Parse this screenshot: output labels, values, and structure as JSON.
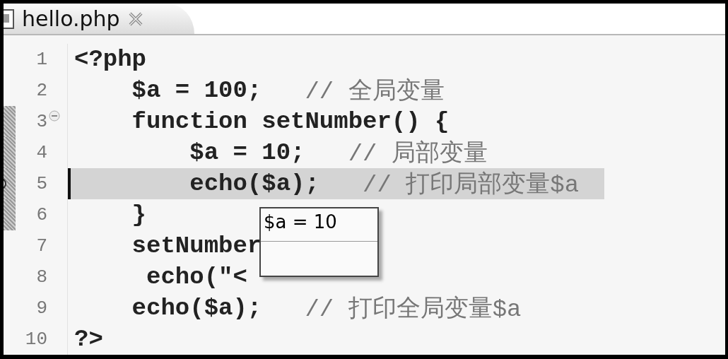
{
  "tab": {
    "title": "hello.php",
    "selected": true
  },
  "lines": [
    {
      "number": "1",
      "code": "<?php",
      "current": false,
      "foldable": false,
      "scope": false
    },
    {
      "number": "2",
      "code": "    $a = 100;",
      "comment": "// 全局变量",
      "current": false,
      "foldable": false,
      "scope": false
    },
    {
      "number": "3",
      "code": "    function setNumber() {",
      "current": false,
      "foldable": true,
      "scope": true
    },
    {
      "number": "4",
      "code": "        $a = 10;",
      "comment": "// 局部变量",
      "current": false,
      "foldable": false,
      "scope": true
    },
    {
      "number": "5",
      "code": "        echo($a);",
      "comment": "// 打印局部变量$a",
      "current": true,
      "foldable": false,
      "scope": true
    },
    {
      "number": "6",
      "code": "    }",
      "current": false,
      "foldable": false,
      "scope": true
    },
    {
      "number": "7",
      "code": "    setNumber",
      "current": false,
      "foldable": false,
      "scope": false
    },
    {
      "number": "8",
      "code": "     echo(\"<",
      "current": false,
      "foldable": false,
      "scope": false
    },
    {
      "number": "9",
      "code": "    echo($a);",
      "comment": "// 打印全局变量$a",
      "current": false,
      "foldable": false,
      "scope": false
    },
    {
      "number": "10",
      "code": "?>",
      "current": false,
      "foldable": false,
      "scope": false
    }
  ],
  "tooltip": {
    "text": "$a = 10"
  }
}
